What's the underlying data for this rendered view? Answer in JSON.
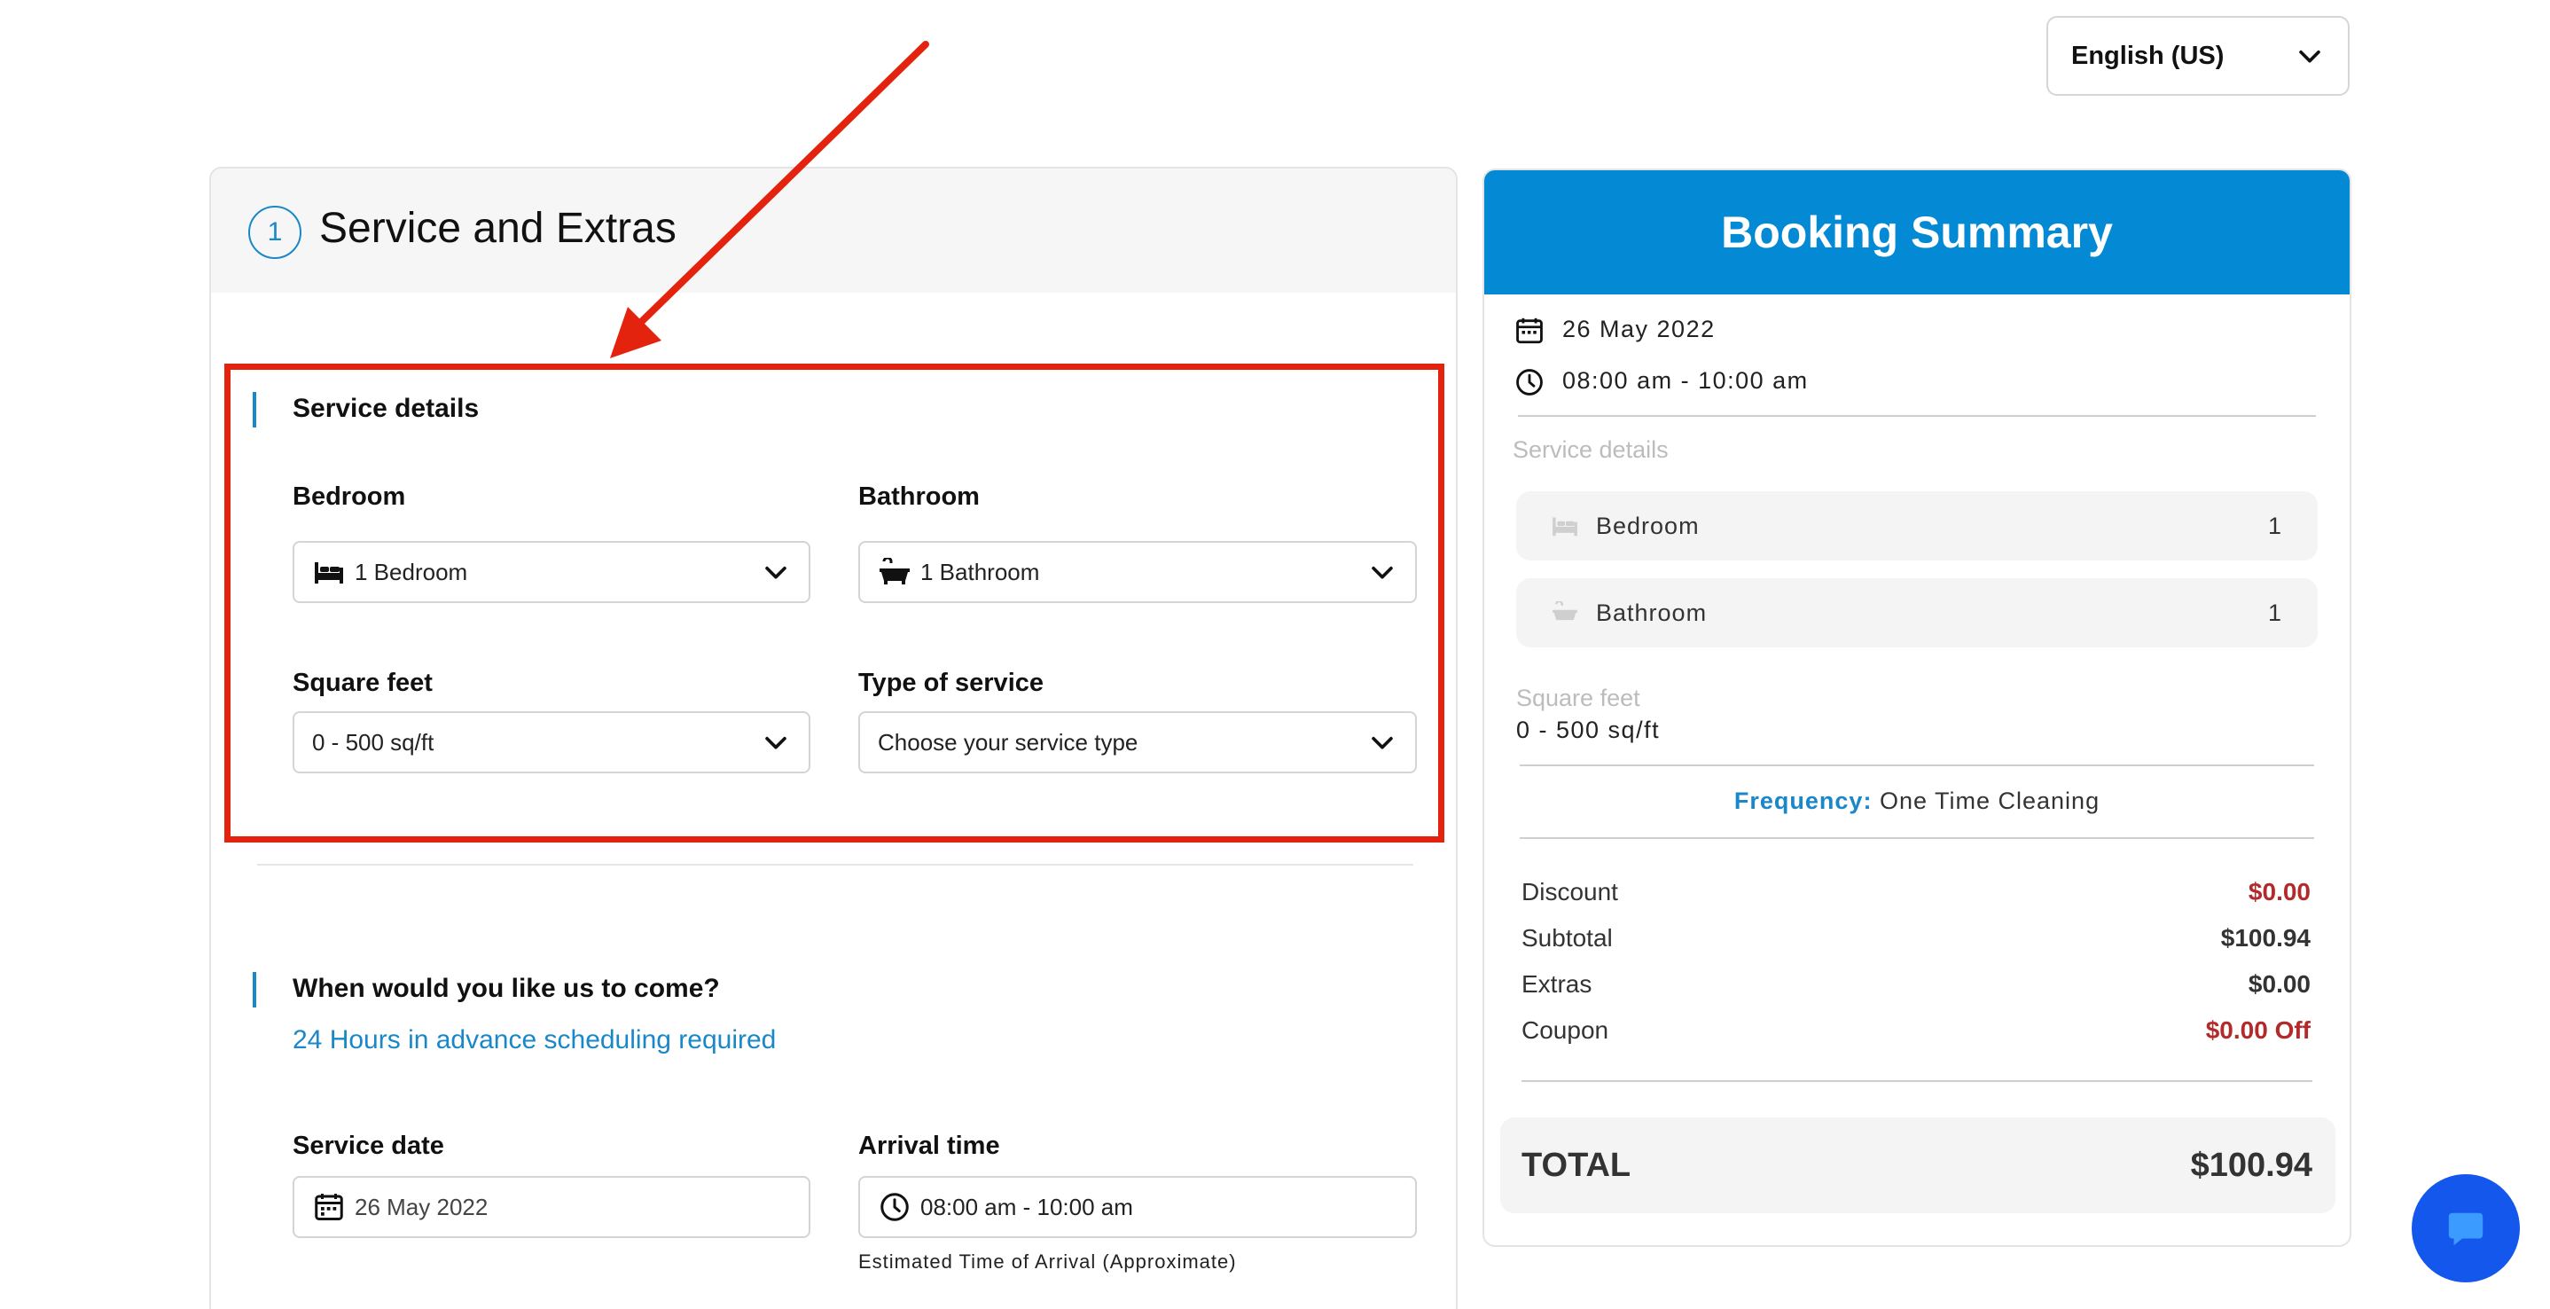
{
  "language": {
    "selected": "English (US)"
  },
  "step": {
    "number": "1",
    "title": "Service and Extras"
  },
  "service_details": {
    "title": "Service details",
    "bedroom": {
      "label": "Bedroom",
      "value": "1 Bedroom"
    },
    "bathroom": {
      "label": "Bathroom",
      "value": "1 Bathroom"
    },
    "square_feet": {
      "label": "Square feet",
      "value": "0 - 500 sq/ft"
    },
    "service_type": {
      "label": "Type of service",
      "value": "Choose your service type"
    }
  },
  "schedule": {
    "title": "When would you like us to come?",
    "hint": "24 Hours in advance scheduling required",
    "service_date": {
      "label": "Service date",
      "value": "26 May 2022"
    },
    "arrival_time": {
      "label": "Arrival time",
      "value": "08:00 am - 10:00 am",
      "note": "Estimated Time of Arrival (Approximate)"
    }
  },
  "summary": {
    "title": "Booking Summary",
    "date": "26 May 2022",
    "time": "08:00 am - 10:00 am",
    "service_details_label": "Service details",
    "bedroom": {
      "label": "Bedroom",
      "value": "1"
    },
    "bathroom": {
      "label": "Bathroom",
      "value": "1"
    },
    "square_feet_label": "Square feet",
    "square_feet_value": "0 - 500 sq/ft",
    "frequency_label": "Frequency:",
    "frequency_value": "One Time Cleaning",
    "discount": {
      "label": "Discount",
      "value": "$0.00"
    },
    "subtotal": {
      "label": "Subtotal",
      "value": "$100.94"
    },
    "extras": {
      "label": "Extras",
      "value": "$0.00"
    },
    "coupon": {
      "label": "Coupon",
      "value": "$0.00 Off"
    },
    "total": {
      "label": "TOTAL",
      "value": "$100.94"
    }
  },
  "colors": {
    "accent": "#0489d4",
    "annotation": "#e3230d",
    "chat": "#1457ec",
    "negative": "#b22a2a"
  }
}
